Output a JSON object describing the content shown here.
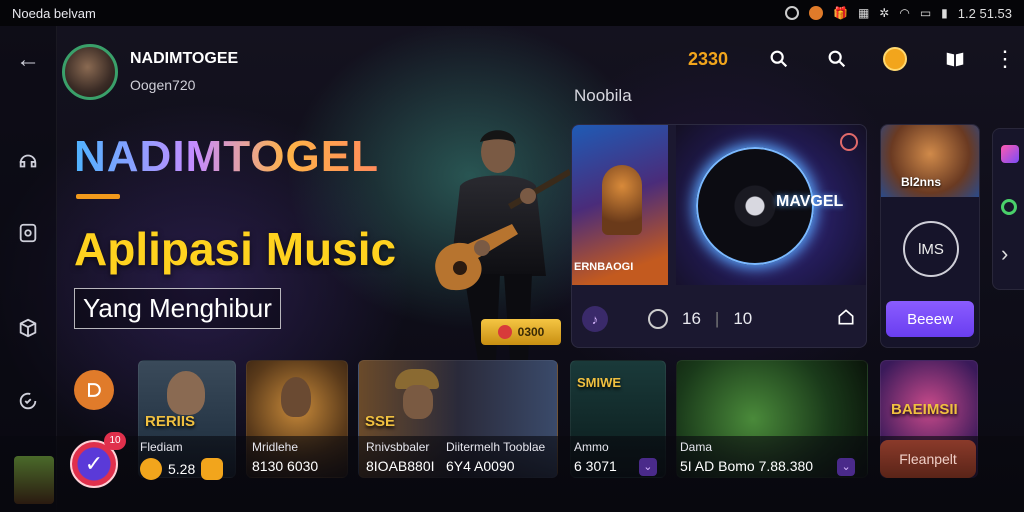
{
  "status_bar": {
    "left_text": "Noeda belvam",
    "right_text": "1.2 51.53"
  },
  "header": {
    "channel_name": "NADIMTOGEE",
    "channel_sub": "Oogen720",
    "count_text": "2330",
    "panel_label": "Noobila"
  },
  "hero": {
    "title": "NADIMTOGEL",
    "subtitle": "Aplipasi Music",
    "tagline": "Yang Menghibur",
    "play_chip": "0300"
  },
  "main_card": {
    "art_caption": "ERNBAOGI",
    "vinyl_label": "MAVGEL",
    "stat1": "16",
    "stat2": "10"
  },
  "side_card": {
    "caption": "Bl2nns",
    "circle_label": "lMS",
    "button_label": "Beeew"
  },
  "thumbs": [
    {
      "label": "RERIIS"
    },
    {
      "label": ""
    },
    {
      "label": "SSE"
    },
    {
      "label": "SMIWE"
    },
    {
      "label": ""
    },
    {
      "label": "BAEIMSII"
    }
  ],
  "bottom_row": {
    "col1_title": "Flediam",
    "col1_value": "5.28",
    "col2_title": "Mridlehe",
    "col2_value": "8130 6030",
    "col3_title": "Rnivsbbaler",
    "col3_value": "8IOAB880I",
    "col4_title": "Diitermelh Tooblae",
    "col4_value": "6Y4 A0090",
    "col5_title": "Ammo",
    "col5_value": "6 3071",
    "col6_title": "Dama",
    "col6_value": "5I AD Bomo 7.88.380",
    "button_label": "Fleanpelt",
    "fab_badge": "10"
  },
  "colors": {
    "accent_yellow": "#ffd21f",
    "accent_orange": "#f29a1c",
    "accent_purple": "#7a4cf8",
    "online_ring": "#3aa06a"
  }
}
